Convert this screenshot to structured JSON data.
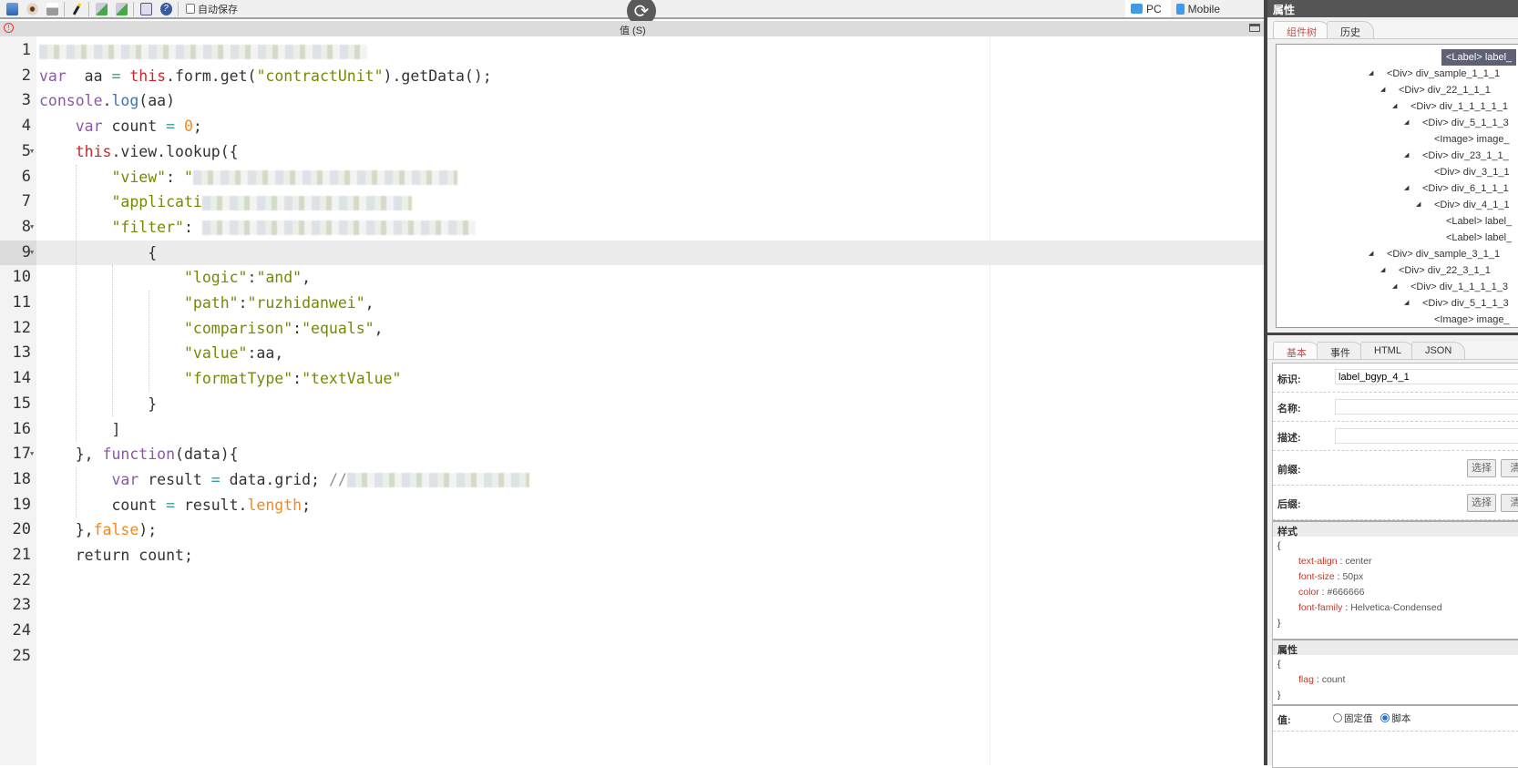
{
  "toolbar": {
    "autosave_label": "自动保存",
    "icons": [
      "save-icon",
      "preview-icon",
      "print-icon",
      "wand-icon",
      "import-icon",
      "export-icon",
      "layout-icon",
      "help-icon"
    ]
  },
  "view_tabs": [
    {
      "label": "PC",
      "active": true
    },
    {
      "label": "Mobile",
      "active": false
    }
  ],
  "editor": {
    "title": "值 (S)",
    "active_line": 9,
    "lines": [
      [
        [
          "redact",
          ""
        ]
      ],
      [
        [
          "kw",
          "var"
        ],
        [
          "",
          "  aa "
        ],
        [
          "op",
          "="
        ],
        [
          "",
          "",
          " "
        ],
        [
          "th",
          "this"
        ],
        [
          "",
          ".form.get("
        ],
        [
          "st",
          "\"contractUnit\""
        ],
        [
          "",
          ").getData();"
        ]
      ],
      [
        [
          "kw",
          "console"
        ],
        [
          "",
          "."
        ],
        [
          "fn",
          "log"
        ],
        [
          "",
          "(aa)"
        ]
      ],
      [
        [
          "",
          "    "
        ],
        [
          "kw",
          "var"
        ],
        [
          "",
          "",
          " count "
        ],
        [
          "op",
          "="
        ],
        [
          "",
          "",
          " "
        ],
        [
          "nu",
          "0"
        ],
        [
          "",
          ";"
        ]
      ],
      [
        [
          "",
          "    "
        ],
        [
          "th",
          "this"
        ],
        [
          "",
          ".view.lookup({"
        ]
      ],
      [
        [
          "",
          "        "
        ],
        [
          "st",
          "\"view\""
        ],
        [
          "",
          ": "
        ],
        [
          "st",
          "\""
        ],
        [
          "redact",
          ""
        ]
      ],
      [
        [
          "",
          "        "
        ],
        [
          "st",
          "\"applicati"
        ],
        [
          "redact",
          ""
        ]
      ],
      [
        [
          "",
          "        "
        ],
        [
          "st",
          "\"filter\""
        ],
        [
          "",
          ": "
        ],
        [
          "redact",
          ""
        ]
      ],
      [
        [
          "",
          "            {"
        ]
      ],
      [
        [
          "",
          "                "
        ],
        [
          "st",
          "\"logic\""
        ],
        [
          "",
          ":"
        ],
        [
          "st",
          "\"and\""
        ],
        [
          "",
          ","
        ]
      ],
      [
        [
          "",
          "                "
        ],
        [
          "st",
          "\"path\""
        ],
        [
          "",
          ":"
        ],
        [
          "st",
          "\"ruzhidanwei\""
        ],
        [
          "",
          ","
        ]
      ],
      [
        [
          "",
          "                "
        ],
        [
          "st",
          "\"comparison\""
        ],
        [
          "",
          ":"
        ],
        [
          "st",
          "\"equals\""
        ],
        [
          "",
          ","
        ]
      ],
      [
        [
          "",
          "                "
        ],
        [
          "st",
          "\"value\""
        ],
        [
          "",
          ":aa,"
        ]
      ],
      [
        [
          "",
          "                "
        ],
        [
          "st",
          "\"formatType\""
        ],
        [
          "",
          ":"
        ],
        [
          "st",
          "\"textValue\""
        ]
      ],
      [
        [
          "",
          "            }"
        ]
      ],
      [
        [
          "",
          "        ]"
        ]
      ],
      [
        [
          "",
          "    }, "
        ],
        [
          "kw",
          "function"
        ],
        [
          "",
          "(data){"
        ]
      ],
      [
        [
          "",
          "        "
        ],
        [
          "kw",
          "var"
        ],
        [
          "",
          "",
          " result "
        ],
        [
          "op",
          "="
        ],
        [
          "",
          "",
          " data.grid; "
        ],
        [
          "cm",
          "//"
        ],
        [
          "redact",
          ""
        ]
      ],
      [
        [
          "",
          "        count "
        ],
        [
          "op",
          "="
        ],
        [
          "",
          "",
          " result."
        ],
        [
          "nu",
          "length"
        ],
        [
          "",
          ";"
        ]
      ],
      [
        [
          "",
          "    },"
        ],
        [
          "nu",
          "false"
        ],
        [
          "",
          ");"
        ]
      ],
      [
        [
          "",
          "    return count;"
        ]
      ],
      [],
      [],
      [],
      []
    ],
    "fold_lines": [
      5,
      8,
      9,
      17
    ]
  },
  "panel": {
    "title": "属性",
    "tree_tabs": [
      "组件树",
      "历史"
    ],
    "tree": [
      {
        "label": "<Label> label_",
        "level": 5,
        "selected": true,
        "expandable": false
      },
      {
        "label": "<Div> div_sample_1_1_1",
        "level": 0,
        "expandable": true
      },
      {
        "label": "<Div> div_22_1_1_1",
        "level": 1,
        "expandable": true
      },
      {
        "label": "<Div> div_1_1_1_1_1",
        "level": 2,
        "expandable": true
      },
      {
        "label": "<Div> div_5_1_1_3",
        "level": 3,
        "expandable": true
      },
      {
        "label": "<Image> image_",
        "level": 4,
        "expandable": false
      },
      {
        "label": "<Div> div_23_1_1_",
        "level": 3,
        "expandable": true
      },
      {
        "label": "<Div> div_3_1_1",
        "level": 4,
        "expandable": false
      },
      {
        "label": "<Div> div_6_1_1_1",
        "level": 3,
        "expandable": true
      },
      {
        "label": "<Div> div_4_1_1",
        "level": 4,
        "expandable": true
      },
      {
        "label": "<Label> label_",
        "level": 5,
        "expandable": false
      },
      {
        "label": "<Label> label_",
        "level": 5,
        "expandable": false
      },
      {
        "label": "<Div> div_sample_3_1_1",
        "level": 0,
        "expandable": true
      },
      {
        "label": "<Div> div_22_3_1_1",
        "level": 1,
        "expandable": true
      },
      {
        "label": "<Div> div_1_1_1_1_3",
        "level": 2,
        "expandable": true
      },
      {
        "label": "<Div> div_5_1_1_3",
        "level": 3,
        "expandable": true
      },
      {
        "label": "<Image> image_",
        "level": 4,
        "expandable": false
      }
    ],
    "prop_tabs": [
      "基本",
      "事件",
      "HTML",
      "JSON"
    ],
    "fields": {
      "id_label": "标识:",
      "id_value": "label_bgyp_4_1",
      "name_label": "名称:",
      "name_value": "",
      "desc_label": "描述:",
      "desc_value": "",
      "prefix_label": "前缀:",
      "suffix_label": "后缀:",
      "select_btn": "选择",
      "clear_btn": "清"
    },
    "style_header": "样式",
    "style": [
      [
        "text-align",
        "center"
      ],
      [
        "font-size",
        "50px"
      ],
      [
        "color",
        "#666666"
      ],
      [
        "font-family",
        "Helvetica-Condensed"
      ]
    ],
    "attr_header": "属性",
    "attrs": [
      [
        "flag",
        "count"
      ]
    ],
    "value_label": "值:",
    "value_options": [
      {
        "label": "固定值",
        "checked": false
      },
      {
        "label": "脚本",
        "checked": true
      }
    ],
    "brace_open": "{",
    "brace_close": "}"
  }
}
